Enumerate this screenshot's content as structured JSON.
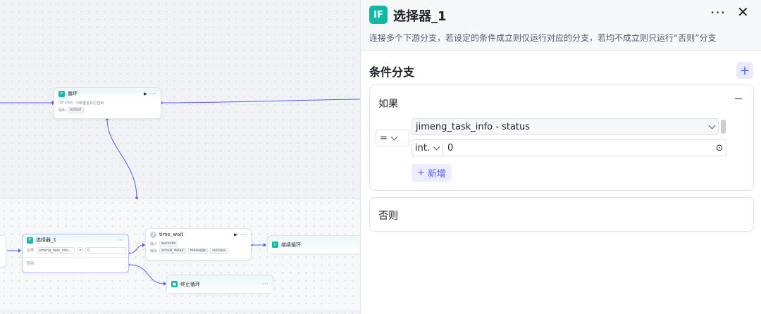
{
  "canvas": {
    "loop_node": {
      "title": "循环",
      "row1_label": "Iteration",
      "row1_value": "不断重复执行直到",
      "row2_label": "输出",
      "row2_tag": "output"
    },
    "selector_node": {
      "title": "选择器_1",
      "if_label": "如果",
      "if_var": "jimeng_task_info...",
      "if_op": "=",
      "if_value": "0",
      "else_label": "否则"
    },
    "time_wait_node": {
      "title": "time_wait",
      "input_label": "输入",
      "input_tag": "seconds",
      "output_label": "输出",
      "output_tags": [
        "actual_delay",
        "message",
        "success"
      ]
    },
    "continue_node": {
      "title": "继续循环"
    },
    "stop_node": {
      "title": "终止循环"
    }
  },
  "panel": {
    "icon_text": "IF",
    "title": "选择器_1",
    "more_icon": "more-icon",
    "close_icon": "close-icon",
    "description": "连接多个下游分支，若设定的条件成立则仅运行对应的分支，若均不成立则只运行“否则”分支",
    "section_title": "条件分支",
    "if_card": {
      "label": "如果",
      "operator": "=",
      "variable": "jimeng_task_info - status",
      "value_type": "int.",
      "value": "0",
      "add_label": "新增"
    },
    "else_card": {
      "label": "否则"
    }
  },
  "colors": {
    "accent": "#4e5ee8",
    "if_icon": "#12b8a6",
    "wire": "#4e5ee8"
  }
}
